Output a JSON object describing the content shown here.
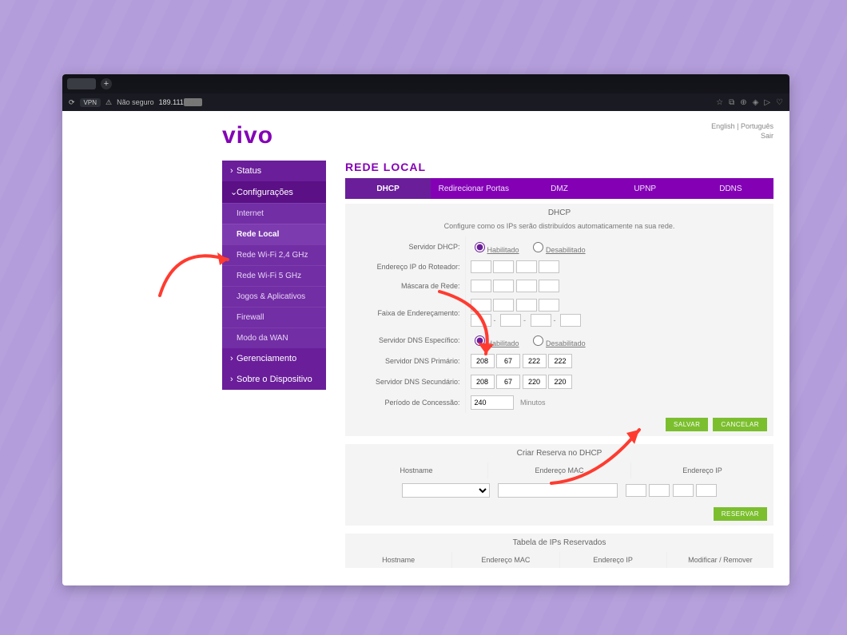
{
  "browser": {
    "vpn_badge": "VPN",
    "insecure_label": "Não seguro",
    "url_visible_prefix": "189.111",
    "toolbar_icons": [
      "bookmark",
      "camera",
      "refresh-circle",
      "shield",
      "play",
      "heart"
    ]
  },
  "header": {
    "brand": "vivo",
    "lang_en": "English",
    "lang_sep": " | ",
    "lang_pt": "Português",
    "logout": "Sair"
  },
  "sidebar": {
    "sections": [
      {
        "label": "Status",
        "expanded": false
      },
      {
        "label": "Configurações",
        "expanded": true
      },
      {
        "label": "Gerenciamento",
        "expanded": false
      },
      {
        "label": "Sobre o Dispositivo",
        "expanded": false
      }
    ],
    "config_items": [
      "Internet",
      "Rede Local",
      "Rede Wi-Fi 2,4 GHz",
      "Rede Wi-Fi 5 GHz",
      "Jogos & Aplicativos",
      "Firewall",
      "Modo da WAN"
    ],
    "active_config_item": "Rede Local"
  },
  "main": {
    "page_title": "REDE LOCAL",
    "tabs": [
      "DHCP",
      "Redirecionar Portas",
      "DMZ",
      "UPNP",
      "DDNS"
    ],
    "active_tab": "DHCP",
    "dhcp": {
      "panel_title": "DHCP",
      "panel_desc": "Configure como os IPs serão distribuídos automaticamente na sua rede.",
      "labels": {
        "server": "Servidor DHCP:",
        "router_ip": "Endereço IP do Roteador:",
        "netmask": "Máscara de Rede:",
        "range": "Faixa de Endereçamento:",
        "specific_dns": "Servidor DNS Específico:",
        "dns1": "Servidor DNS Primário:",
        "dns2": "Servidor DNS Secundário:",
        "lease": "Período de Concessão:"
      },
      "radio": {
        "enabled": "Habilitado",
        "disabled": "Desabilitado"
      },
      "server_value": "Habilitado",
      "router_ip": [
        "",
        "",
        "",
        ""
      ],
      "netmask": [
        "",
        "",
        "",
        ""
      ],
      "range_from": [
        "",
        "",
        "",
        ""
      ],
      "range_to": [
        "",
        "",
        "",
        ""
      ],
      "specific_dns_value": "Habilitado",
      "dns1": [
        "208",
        "67",
        "222",
        "222"
      ],
      "dns2": [
        "208",
        "67",
        "220",
        "220"
      ],
      "lease_value": "240",
      "lease_unit": "Minutos",
      "save": "SALVAR",
      "cancel": "CANCELAR"
    },
    "reservation": {
      "panel_title": "Criar Reserva no DHCP",
      "cols": [
        "Hostname",
        "Endereço MAC",
        "Endereço IP"
      ],
      "ip_parts": [
        "",
        "",
        "",
        ""
      ],
      "reserve": "RESERVAR"
    },
    "reserved_table": {
      "panel_title": "Tabela de IPs Reservados",
      "cols": [
        "Hostname",
        "Endereço MAC",
        "Endereço IP",
        "Modificar / Remover"
      ]
    }
  }
}
